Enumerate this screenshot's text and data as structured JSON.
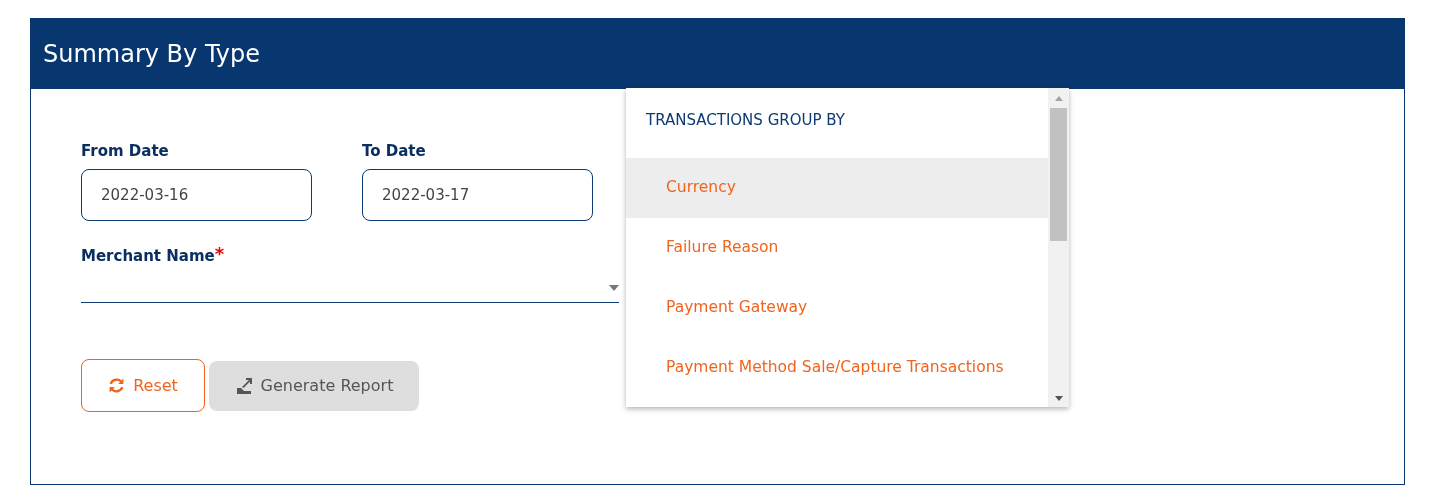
{
  "title": "Summary By Type",
  "dates": [
    {
      "label": "From Date",
      "value": "2022-03-16"
    },
    {
      "label": "To Date",
      "value": "2022-03-17"
    }
  ],
  "merchant": {
    "label": "Merchant Name",
    "required": true,
    "required_mark": "*"
  },
  "buttons": [
    {
      "kind": "reset",
      "label": "Reset",
      "disabled": false
    },
    {
      "kind": "generate",
      "label": "Generate Report",
      "disabled": true
    }
  ],
  "dropdown": {
    "header": "TRANSACTIONS GROUP BY",
    "options": [
      {
        "label": "Currency",
        "selected": true
      },
      {
        "label": "Failure Reason",
        "selected": false
      },
      {
        "label": "Payment Gateway",
        "selected": false
      },
      {
        "label": "Payment Method Sale/Capture Transactions",
        "selected": false
      }
    ]
  }
}
